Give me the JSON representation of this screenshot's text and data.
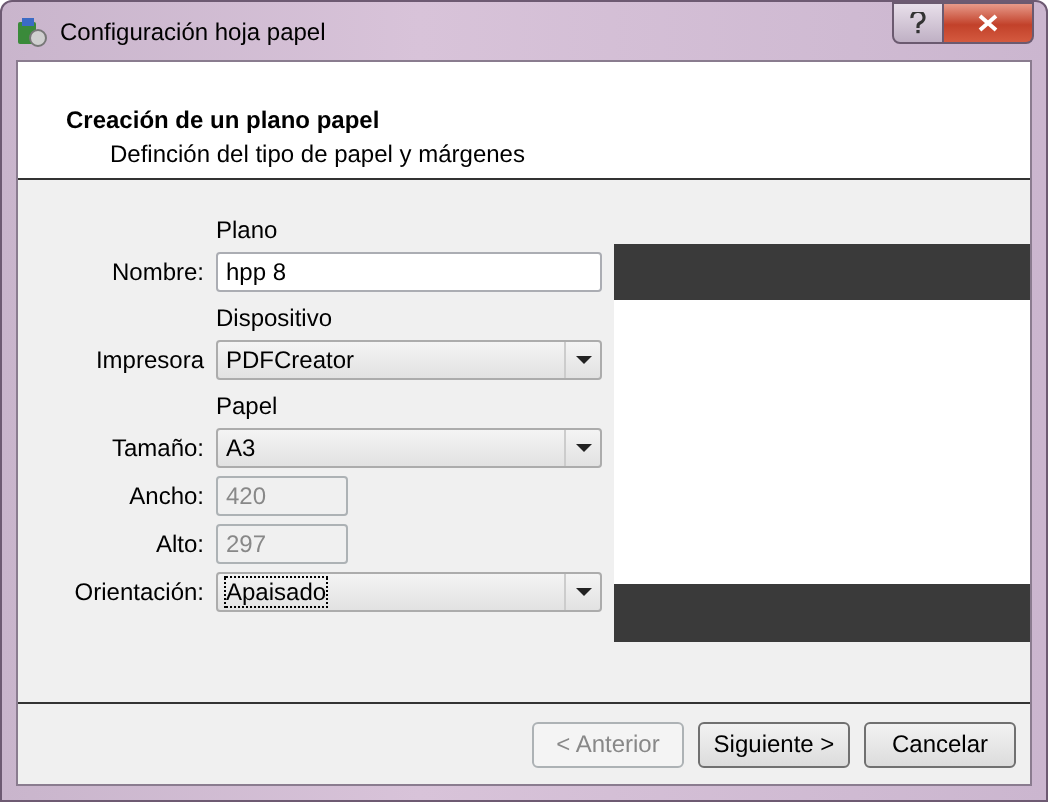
{
  "window": {
    "title": "Configuración hoja papel"
  },
  "header": {
    "title": "Creación de un plano papel",
    "subtitle": "Definción del tipo de papel y márgenes"
  },
  "sections": [
    {
      "title": "Plano",
      "fields": [
        {
          "label": "Nombre:",
          "kind": "text",
          "value": "hpp 8"
        }
      ]
    },
    {
      "title": "Dispositivo",
      "fields": [
        {
          "label": "Impresora",
          "kind": "combo",
          "value": "PDFCreator",
          "focused": false
        }
      ]
    },
    {
      "title": "Papel",
      "fields": [
        {
          "label": "Tamaño:",
          "kind": "combo",
          "value": "A3",
          "focused": false
        },
        {
          "label": "Ancho:",
          "kind": "short",
          "value": "420",
          "disabled": true
        },
        {
          "label": "Alto:",
          "kind": "short",
          "value": "297",
          "disabled": true
        },
        {
          "label": "Orientación:",
          "kind": "combo",
          "value": "Apaisado",
          "focused": true
        }
      ]
    }
  ],
  "buttons": [
    {
      "label": "< Anterior",
      "disabled": true
    },
    {
      "label": "Siguiente >",
      "disabled": false
    },
    {
      "label": "Cancelar",
      "disabled": false
    }
  ]
}
